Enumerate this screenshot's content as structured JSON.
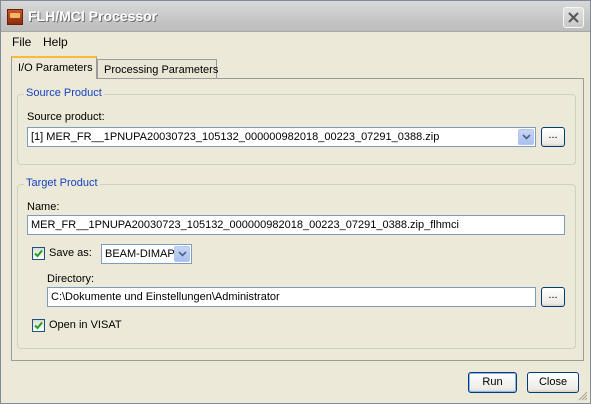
{
  "window": {
    "title": "FLH/MCI Processor",
    "app_icon": "beam-app-icon",
    "close_icon": "close-icon"
  },
  "menu": {
    "items": [
      "File",
      "Help"
    ]
  },
  "tabs": [
    {
      "label": "I/O Parameters",
      "active": true
    },
    {
      "label": "Processing Parameters",
      "active": false
    }
  ],
  "source_group": {
    "title": "Source Product",
    "product_label": "Source product:",
    "product_value": "[1] MER_FR__1PNUPA20030723_105132_000000982018_00223_07291_0388.zip",
    "browse_label": "..."
  },
  "target_group": {
    "title": "Target Product",
    "name_label": "Name:",
    "name_value": "MER_FR__1PNUPA20030723_105132_000000982018_00223_07291_0388.zip_flhmci",
    "save_as": {
      "checked": true,
      "label": "Save as:"
    },
    "format_value": "BEAM-DIMAP",
    "directory_label": "Directory:",
    "directory_value": "C:\\Dokumente und Einstellungen\\Administrator",
    "browse_label": "...",
    "open_in_visat": {
      "checked": true,
      "label": "Open in VISAT"
    }
  },
  "buttons": {
    "run": "Run",
    "close": "Close"
  },
  "colors": {
    "window_bg": "#ece9d8",
    "group_title": "#1542c0",
    "field_border": "#7f9db9",
    "button_border": "#003c74",
    "active_tab_accent": "#ffb73c"
  }
}
